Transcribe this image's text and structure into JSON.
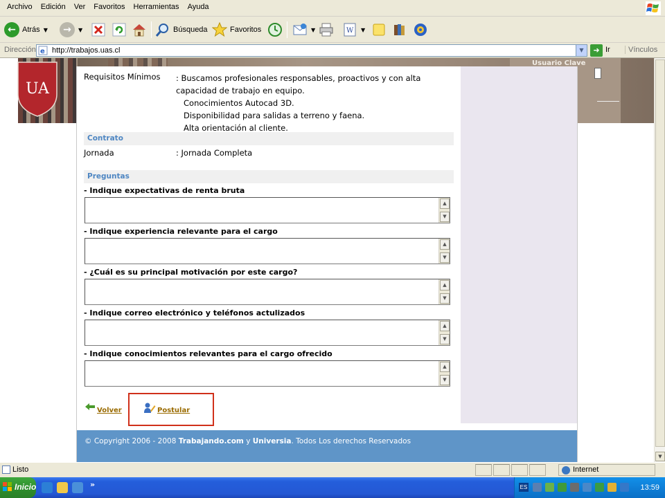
{
  "menu": [
    "Archivo",
    "Edición",
    "Ver",
    "Favoritos",
    "Herramientas",
    "Ayuda"
  ],
  "toolbar": {
    "back_label": "Atrás",
    "search_label": "Búsqueda",
    "favorites_label": "Favoritos"
  },
  "address": {
    "label": "Dirección",
    "url": "http://trabajos.uas.cl",
    "go_label": "Ir",
    "links_label": "Vínculos"
  },
  "banner": {
    "logo_text": "UA",
    "login_label": "Usuario   Clave"
  },
  "job": {
    "requirements_label": "Requisitos Mínimos",
    "requirements_intro": ": Buscamos profesionales responsables, proactivos y con alta capacidad de trabajo en equipo.",
    "requirements_items": [
      "Conocimientos Autocad 3D.",
      "Disponibilidad para salidas a terreno y faena.",
      "Alta orientación al cliente."
    ],
    "contract_header": "Contrato",
    "jornada_label": "Jornada",
    "jornada_value": ": Jornada Completa",
    "questions_header": "Preguntas",
    "questions": [
      "- Indique expectativas de renta bruta",
      "- Indique experiencia relevante para el cargo",
      "- ¿Cuál es su principal motivación por este cargo?",
      "- Indique correo electrónico y teléfonos actulizados",
      "- Indique conocimientos relevantes para el cargo ofrecido"
    ],
    "volver_label": "Volver",
    "postular_label": "Postular"
  },
  "footer": {
    "copyright": "© Copyright 2006 - 2008 ",
    "brand1": "Trabajando.com",
    "connector": " y ",
    "brand2": "Universia",
    "rights": ". Todos Los derechos Reservados"
  },
  "status": {
    "text": "Listo",
    "zone": "Internet"
  },
  "taskbar": {
    "start_label": "Inicio",
    "chevron": "»",
    "lang": "ES",
    "clock": "13:59"
  },
  "colors": {
    "section_header": "#4e86c2",
    "footer_bg": "#5f95c8",
    "link": "#9a6b00",
    "highlight": "#d0301a",
    "crest": "#b3262c"
  }
}
